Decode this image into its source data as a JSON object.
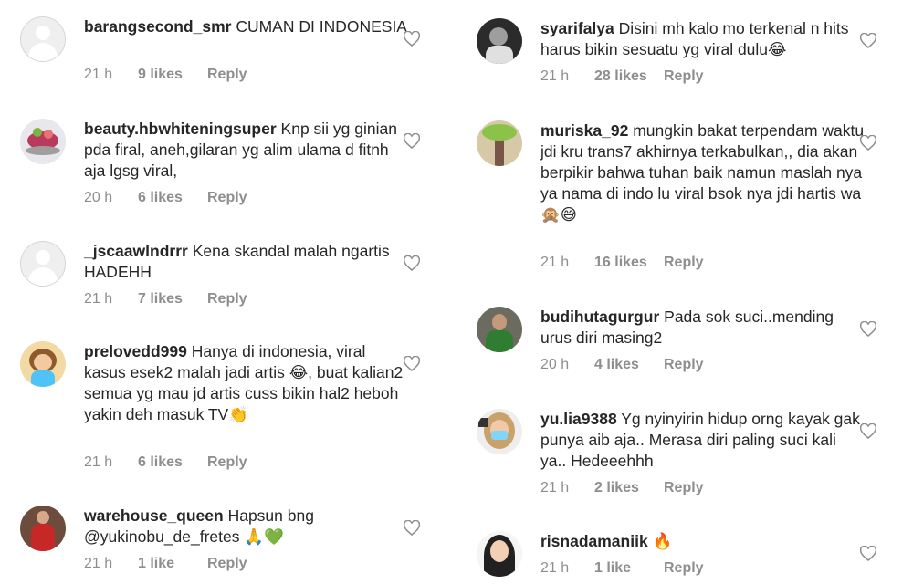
{
  "reply_label": "Reply",
  "left_comments": [
    {
      "username": "barangsecond_smr",
      "text": "CUMAN DI INDONESIA",
      "time": "21 h",
      "likes": "9 likes",
      "avatar": "blank"
    },
    {
      "username": "beauty.hbwhiteningsuper",
      "text": "Knp sii yg ginian pda firal, aneh,gilaran yg alim ulama d fitnh aja lgsg viral,",
      "time": "20 h",
      "likes": "6 likes",
      "avatar": "fruit"
    },
    {
      "username": "_jscaawlndrrr",
      "text": "Kena skandal malah ngartis HADEHH",
      "time": "21 h",
      "likes": "7 likes",
      "avatar": "blank"
    },
    {
      "username": "prelovedd999",
      "text": "Hanya di indonesia, viral kasus esek2 malah jadi artis 😂, buat kalian2 semua yg mau jd artis cuss bikin hal2 heboh yakin deh masuk TV👏",
      "time": "21 h",
      "likes": "6 likes",
      "avatar": "cartoon"
    },
    {
      "username": "warehouse_queen",
      "text": "Hapsun bng @yukinobu_de_fretes 🙏💚",
      "time": "21 h",
      "likes": "1 like",
      "avatar": "dress"
    }
  ],
  "right_comments": [
    {
      "username": "syarifalya",
      "text": "Disini mh kalo mo terkenal n hits harus bikin sesuatu yg viral dulu😂",
      "time": "21 h",
      "likes": "28 likes",
      "avatar": "dark"
    },
    {
      "username": "muriska_92",
      "text": "mungkin bakat terpendam waktu jdi kru trans7 akhirnya terkabulkan,, dia akan berpikir bahwa tuhan baik namun maslah nya ya nama di indo lu viral bsok nya jdi hartis wa🙊😅",
      "time": "21 h",
      "likes": "16 likes",
      "avatar": "tree"
    },
    {
      "username": "budihutagurgur",
      "text": "Pada sok suci..mending urus diri masing2",
      "time": "20 h",
      "likes": "4 likes",
      "avatar": "man"
    },
    {
      "username": "yu.lia9388",
      "text": "Yg nyinyirin hidup orng kayak gak punya aib aja.. Merasa diri paling suci kali ya.. Hedeeehhh",
      "time": "21 h",
      "likes": "2 likes",
      "avatar": "hijab"
    },
    {
      "username": "risnadamaniik",
      "text": "🔥",
      "time": "21 h",
      "likes": "1 like",
      "avatar": "woman"
    }
  ],
  "colors": {
    "username": "#262626",
    "meta": "#8e8e8e",
    "heart": "#8e8e8e"
  }
}
